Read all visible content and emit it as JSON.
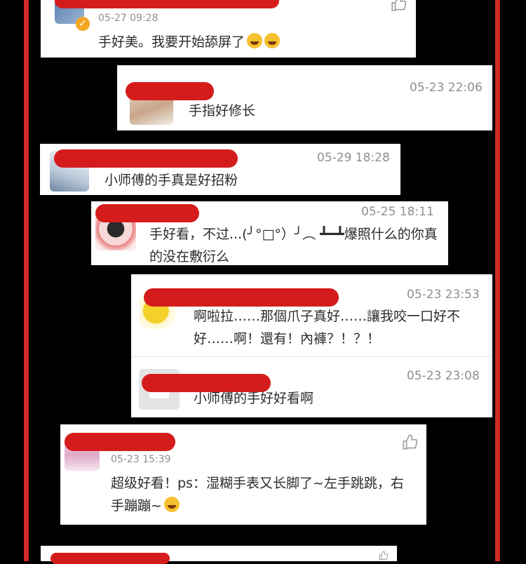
{
  "comments": [
    {
      "timestamp": "05-27 09:28",
      "text": "手好美。我要开始舔屏了"
    },
    {
      "timestamp": "05-23 22:06",
      "text": "手指好修长"
    },
    {
      "timestamp": "05-29 18:28",
      "text": "小师傅的手真是好招粉"
    },
    {
      "timestamp": "05-25 18:11",
      "text": "手好看，不过...(╯°□°）╯︵ ┻━┻爆照什么的你真的没在敷衍么"
    },
    {
      "timestamp": "05-23 23:53",
      "text": "啊啦拉……那個爪子真好……讓我咬一口好不好……啊！還有！內褲？！？！"
    },
    {
      "timestamp": "05-23 23:08",
      "text": "小师傅的手好好看啊"
    },
    {
      "timestamp": "05-23 15:39",
      "text": "超级好看！ps：湿糊手表又长脚了~左手跳跳，右手蹦蹦~"
    }
  ],
  "icons": {
    "like": "thumbs-up-icon",
    "verified": "verified-badge-icon",
    "emoji_laugh": "laughing-emoji-icon",
    "emoji_think": "thinking-emoji-icon"
  },
  "colors": {
    "frame_red": "#d12a27",
    "redaction_red": "#d51c1c",
    "background": "#000000",
    "timestamp_gray": "#8f8f8f"
  }
}
